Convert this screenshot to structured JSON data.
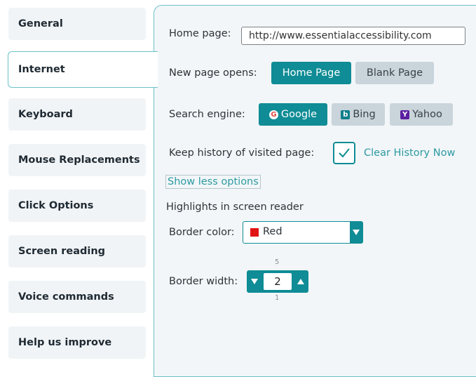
{
  "sidebar": {
    "items": [
      {
        "label": "General"
      },
      {
        "label": "Internet",
        "active": true
      },
      {
        "label": "Keyboard"
      },
      {
        "label": "Mouse Replacements"
      },
      {
        "label": "Click Options"
      },
      {
        "label": "Screen reading"
      },
      {
        "label": "Voice commands"
      },
      {
        "label": "Help us improve"
      }
    ]
  },
  "internet": {
    "home_page_label": "Home page:",
    "home_page_value": "http://www.essentialaccessibility.com",
    "new_page_label": "New page opens:",
    "new_page_options": [
      {
        "label": "Home Page",
        "selected": true
      },
      {
        "label": "Blank Page",
        "selected": false
      }
    ],
    "search_engine_label": "Search engine:",
    "search_engines": [
      {
        "label": "Google",
        "icon": "google-icon",
        "selected": true
      },
      {
        "label": "Bing",
        "icon": "bing-icon",
        "selected": false
      },
      {
        "label": "Yahoo",
        "icon": "yahoo-icon",
        "selected": false
      }
    ],
    "keep_history_label": "Keep history of visited page:",
    "keep_history_checked": true,
    "clear_history_label": "Clear History Now",
    "show_less_label": "Show less options",
    "highlights_heading": "Highlights in screen reader",
    "border_color_label": "Border color:",
    "border_color_value": "Red",
    "border_color_swatch": "#e01414",
    "border_width_label": "Border width:",
    "border_width_value": "2",
    "border_width_max": "5",
    "border_width_min": "1"
  },
  "colors": {
    "accent": "#0f8c95",
    "link": "#2c9aa2",
    "panel_bg": "#f2f6f8",
    "nav_bg": "#f1f4f6"
  }
}
